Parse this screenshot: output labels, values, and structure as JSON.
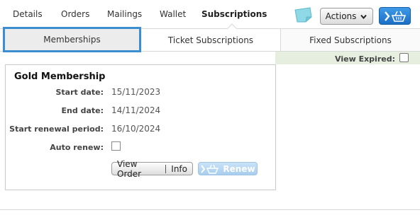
{
  "tabs": [
    {
      "label": "Details",
      "active": false
    },
    {
      "label": "Orders",
      "active": false
    },
    {
      "label": "Mailings",
      "active": false
    },
    {
      "label": "Wallet",
      "active": false
    },
    {
      "label": "Subscriptions",
      "active": true
    }
  ],
  "toolbar": {
    "actions_label": "Actions",
    "icons": [
      "sticky-note-icon",
      "chevron-down-icon",
      "basket-icon"
    ]
  },
  "subtabs": [
    {
      "label": "Memberships",
      "selected": true
    },
    {
      "label": "Ticket Subscriptions",
      "selected": false
    },
    {
      "label": "Fixed Subscriptions",
      "selected": false
    }
  ],
  "filter": {
    "view_expired_label": "View Expired:",
    "view_expired_checked": false
  },
  "membership": {
    "title": "Gold Membership",
    "fields": [
      {
        "label": "Start date:",
        "value": "15/11/2023"
      },
      {
        "label": "End date:",
        "value": "14/11/2024"
      },
      {
        "label": "Start renewal period:",
        "value": "16/10/2024"
      }
    ],
    "auto_renew_label": "Auto renew:",
    "auto_renew_checked": false,
    "view_order_label": "View Order",
    "info_label": "Info",
    "renew_label": "Renew"
  },
  "colors": {
    "accent_blue": "#1a6fc4",
    "selected_outline": "#3b8fd0",
    "filter_bar": "#e6eee0"
  }
}
